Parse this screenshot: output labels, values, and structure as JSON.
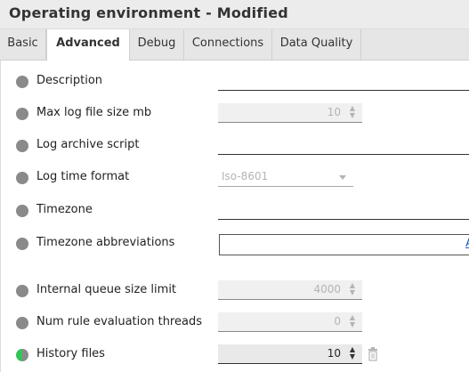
{
  "window": {
    "title": "Operating environment - Modified"
  },
  "tabs": [
    {
      "label": "Basic"
    },
    {
      "label": "Advanced"
    },
    {
      "label": "Debug"
    },
    {
      "label": "Connections"
    },
    {
      "label": "Data Quality"
    }
  ],
  "active_tab": "Advanced",
  "fields": {
    "description": {
      "label": "Description",
      "value": ""
    },
    "max_log_file_size": {
      "label": "Max log file size mb",
      "value": "10",
      "disabled": true
    },
    "log_archive_script": {
      "label": "Log archive script",
      "value": ""
    },
    "log_time_format": {
      "label": "Log time format",
      "value": "Iso-8601",
      "disabled": true
    },
    "timezone": {
      "label": "Timezone",
      "value": ""
    },
    "timezone_abbreviations": {
      "label": "Timezone abbreviations",
      "value": "",
      "link": "A"
    },
    "internal_queue_size_limit": {
      "label": "Internal queue size limit",
      "value": "4000",
      "disabled": true
    },
    "num_rule_evaluation_threads": {
      "label": "Num rule evaluation threads",
      "value": "0",
      "disabled": true
    },
    "history_files": {
      "label": "History files",
      "value": "10",
      "modified": true
    }
  },
  "colors": {
    "indicator_default": "#8a8a8a",
    "indicator_modified": "#33c45a",
    "link": "#1a5fb4"
  },
  "icons": {
    "spinner": "up-down-arrows-icon",
    "delete": "trash-icon",
    "select": "chevron-down-icon"
  }
}
